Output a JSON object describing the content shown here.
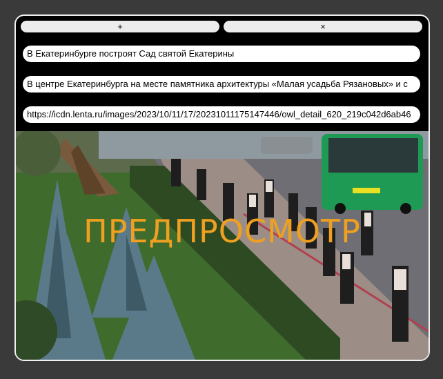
{
  "toolbar": {
    "add_label": "+",
    "close_label": "×"
  },
  "fields": {
    "title": "В Екатеринбурге построят Сад святой Екатерины",
    "summary": "В центре Екатеринбурга на месте памятника архитектуры «Малая усадьба Рязановых» и с",
    "image_url": "https://icdn.lenta.ru/images/2023/10/11/17/20231011175147446/owl_detail_620_219c042d6ab46"
  },
  "preview": {
    "watermark": "ПРЕДПРОСМОТР"
  }
}
